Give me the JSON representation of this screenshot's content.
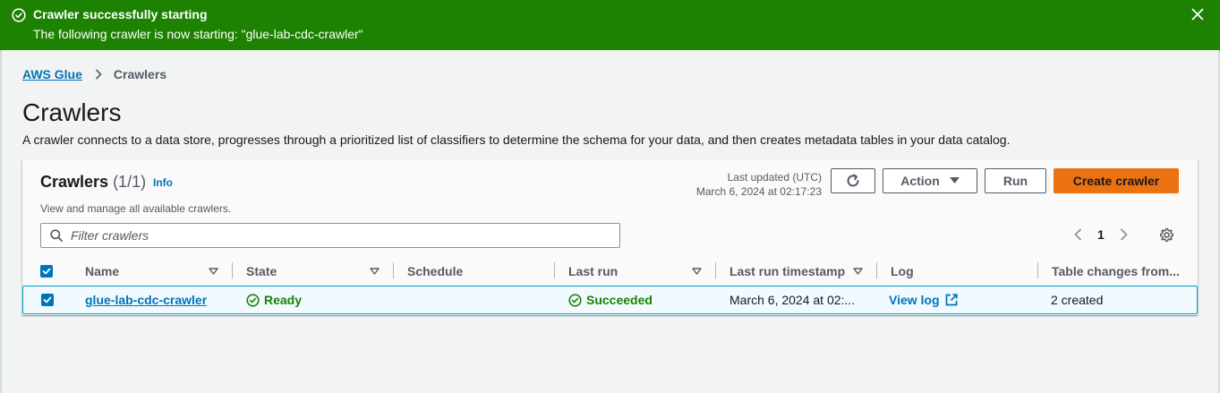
{
  "flash": {
    "title": "Crawler successfully starting",
    "message": "The following crawler is now starting: \"glue-lab-cdc-crawler\"",
    "icon": "success-check-icon",
    "color": "#1d8102"
  },
  "breadcrumb": {
    "root": "AWS Glue",
    "current": "Crawlers"
  },
  "page": {
    "title": "Crawlers",
    "description": "A crawler connects to a data store, progresses through a prioritized list of classifiers to determine the schema for your data, and then creates metadata tables in your data catalog."
  },
  "container": {
    "title": "Crawlers",
    "count": "(1/1)",
    "info": "Info",
    "description": "View and manage all available crawlers.",
    "last_updated_label": "Last updated (UTC)",
    "last_updated_value": "March 6, 2024 at 02:17:23",
    "buttons": {
      "action": "Action",
      "run": "Run",
      "create": "Create crawler"
    },
    "filter_placeholder": "Filter crawlers",
    "page_number": "1",
    "accent_color": "#ec7211"
  },
  "table": {
    "columns": [
      "Name",
      "State",
      "Schedule",
      "Last run",
      "Last run timestamp",
      "Log",
      "Table changes from..."
    ],
    "rows": [
      {
        "selected": true,
        "name": "glue-lab-cdc-crawler",
        "state": "Ready",
        "schedule": "",
        "last_run": "Succeeded",
        "last_run_timestamp": "March 6, 2024 at 02:...",
        "log": "View log",
        "table_changes": "2 created"
      }
    ]
  }
}
